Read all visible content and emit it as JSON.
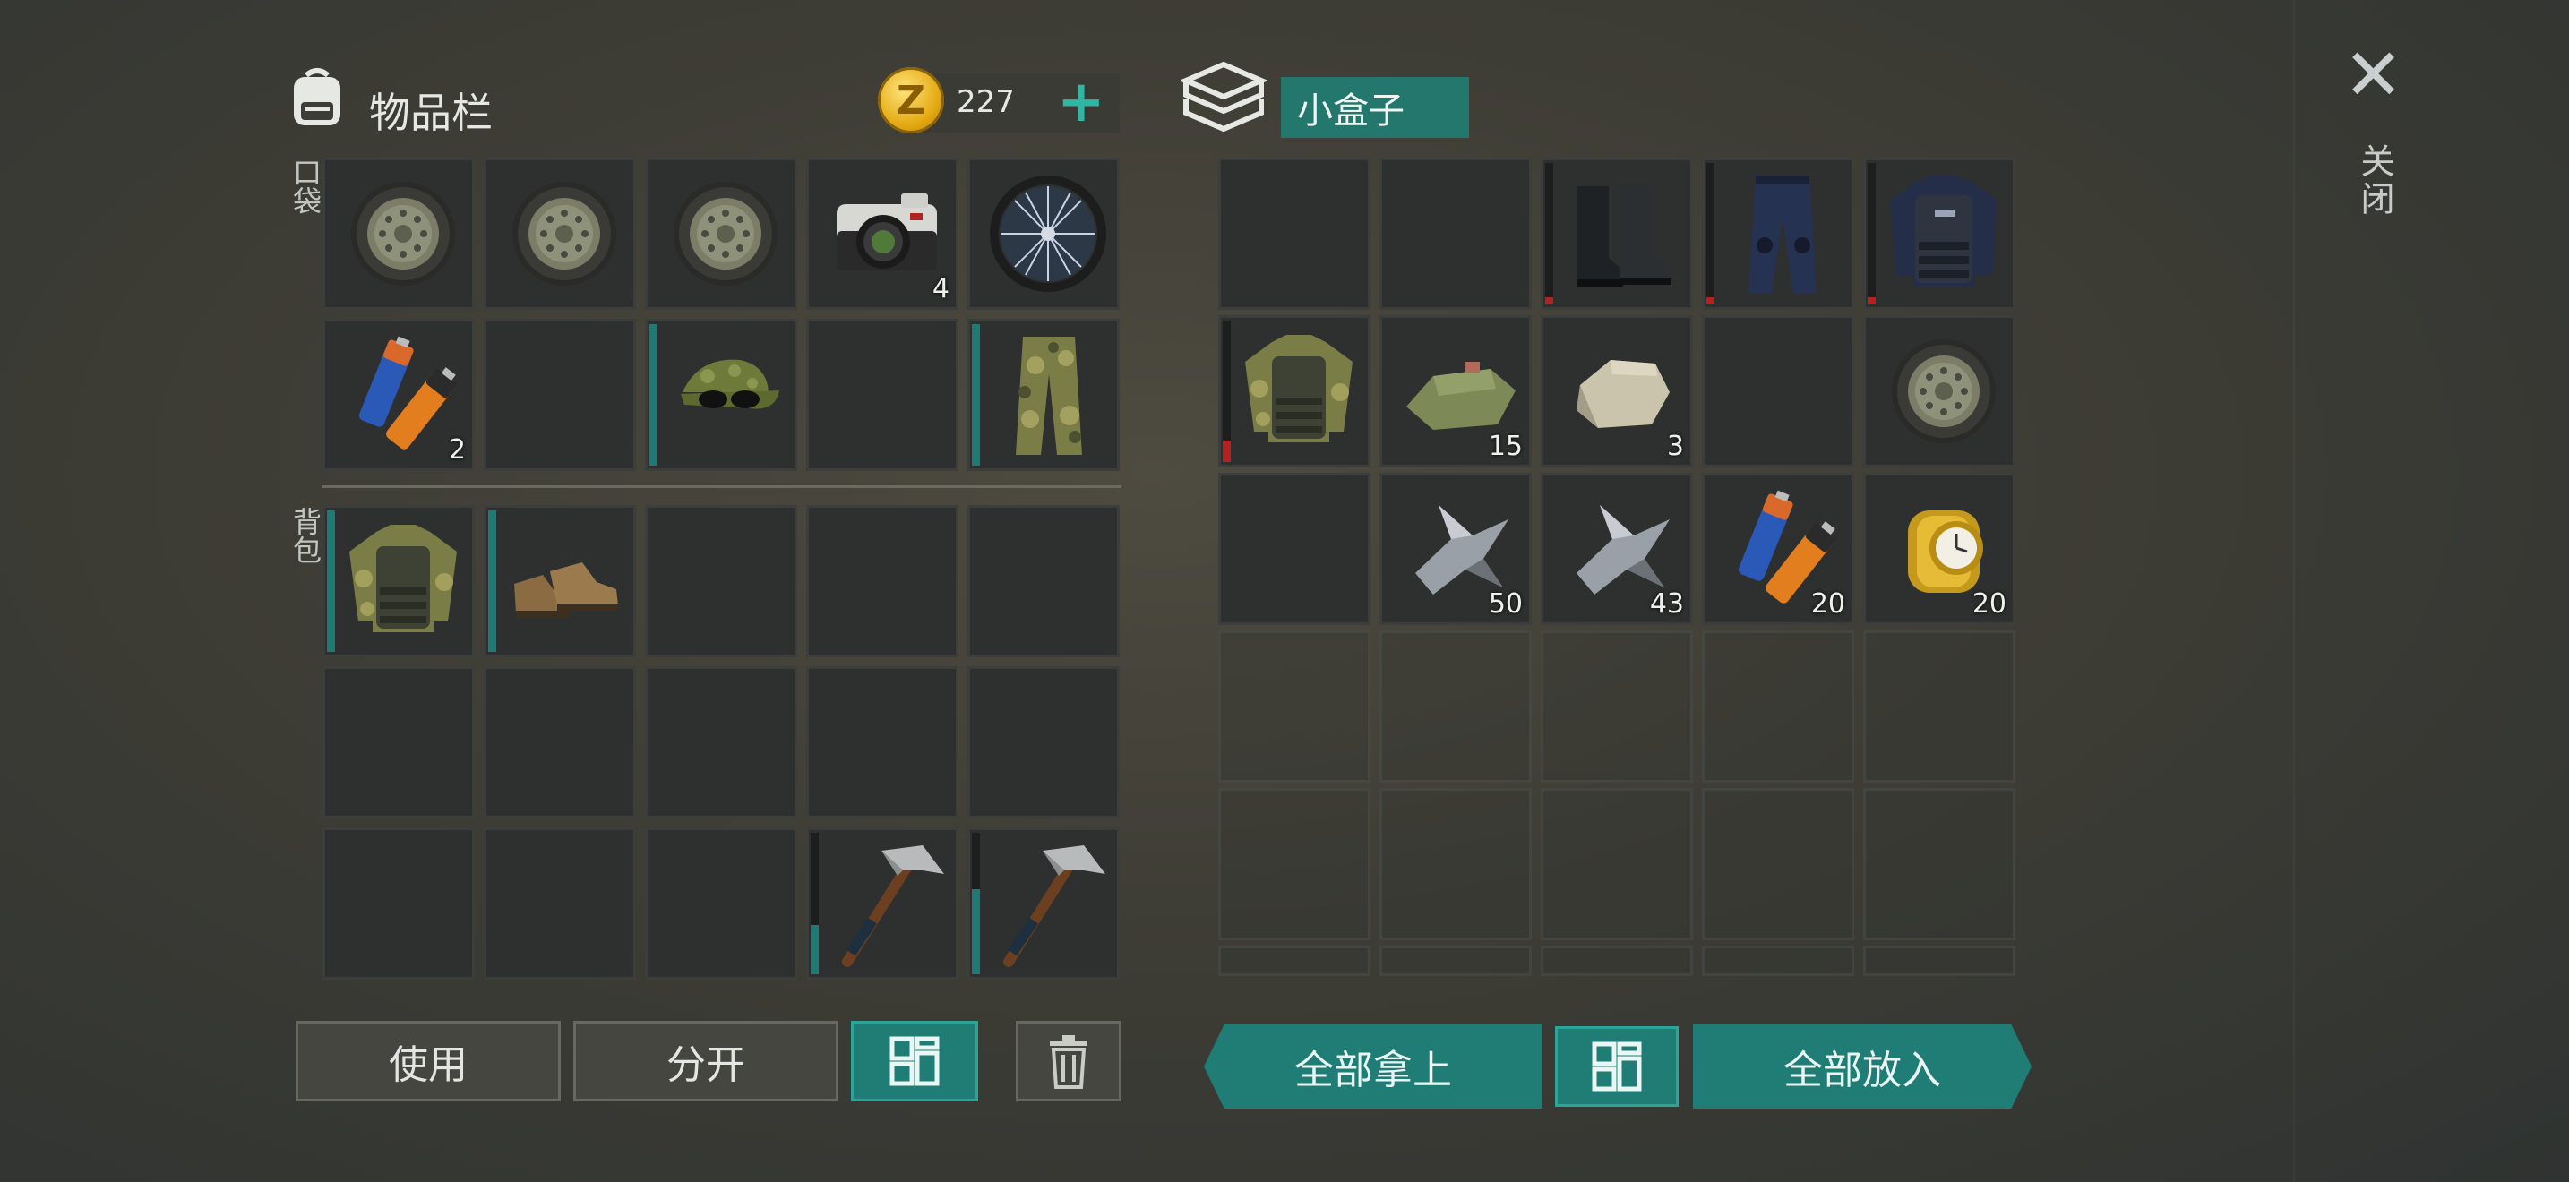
{
  "inventory": {
    "title": "物品栏",
    "coins": "227",
    "pocket_label": "口袋",
    "backpack_label": "背包",
    "buttons": {
      "use": "使用",
      "split": "分开"
    }
  },
  "container": {
    "name": "小盒子",
    "take_all": "全部拿上",
    "put_all": "全部放入"
  },
  "close_label": "关闭",
  "colors": {
    "accent": "#1f7d76",
    "coin": "#e3a912",
    "durability_low": "#b02323"
  },
  "pocket_slots": [
    {
      "item": "wheel-icon",
      "count": ""
    },
    {
      "item": "wheel-icon",
      "count": ""
    },
    {
      "item": "wheel-icon",
      "count": ""
    },
    {
      "item": "camera-icon",
      "count": "4"
    },
    {
      "item": "bicycle-wheel-icon",
      "count": ""
    },
    {
      "item": "batteries-icon",
      "count": "2"
    },
    {
      "item": "",
      "count": ""
    },
    {
      "item": "camo-cap-icon",
      "count": "",
      "durability": 1.0
    },
    {
      "item": "",
      "count": ""
    },
    {
      "item": "camo-pants-icon",
      "count": "",
      "durability": 1.0
    }
  ],
  "backpack_slots": [
    {
      "item": "camo-jacket-icon",
      "count": "",
      "durability": 1.0
    },
    {
      "item": "boots-icon",
      "count": "",
      "durability": 1.0
    },
    {
      "item": "",
      "count": ""
    },
    {
      "item": "",
      "count": ""
    },
    {
      "item": "",
      "count": ""
    },
    {
      "item": "",
      "count": ""
    },
    {
      "item": "",
      "count": ""
    },
    {
      "item": "",
      "count": ""
    },
    {
      "item": "",
      "count": ""
    },
    {
      "item": "",
      "count": ""
    },
    {
      "item": "",
      "count": ""
    },
    {
      "item": "",
      "count": ""
    },
    {
      "item": "",
      "count": ""
    },
    {
      "item": "pickaxe-icon",
      "count": "",
      "durability": 0.35
    },
    {
      "item": "pickaxe-icon",
      "count": "",
      "durability": 0.6
    }
  ],
  "box_slots": [
    {
      "item": "",
      "count": ""
    },
    {
      "item": "",
      "count": ""
    },
    {
      "item": "police-boots-icon",
      "count": "",
      "durability": 0.05
    },
    {
      "item": "police-pants-icon",
      "count": "",
      "durability": 0.05
    },
    {
      "item": "police-vest-icon",
      "count": "",
      "durability": 0.05
    },
    {
      "item": "camo-jacket-icon",
      "count": "",
      "durability": 0.15
    },
    {
      "item": "cloth-icon",
      "count": "15"
    },
    {
      "item": "stone-icon",
      "count": "3"
    },
    {
      "item": "",
      "count": ""
    },
    {
      "item": "wheel-icon",
      "count": ""
    },
    {
      "item": "",
      "count": ""
    },
    {
      "item": "scrap-metal-icon",
      "count": "50"
    },
    {
      "item": "scrap-metal-icon",
      "count": "43"
    },
    {
      "item": "batteries-icon",
      "count": "20"
    },
    {
      "item": "gold-watch-icon",
      "count": "20"
    }
  ]
}
